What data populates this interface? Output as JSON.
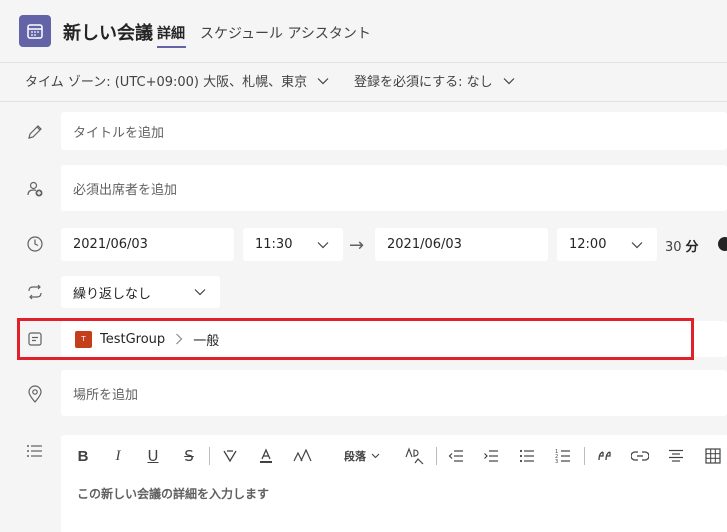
{
  "header": {
    "title": "新しい会議",
    "tabs": [
      {
        "label": "詳細",
        "active": true
      },
      {
        "label": "スケジュール アシスタント",
        "active": false
      }
    ],
    "app_icon": "calendar-icon",
    "accent_color": "#6264a7"
  },
  "options": {
    "timezone": "タイム ゾーン: (UTC+09:00) 大阪、札幌、東京",
    "registration": "登録を必須にする: なし"
  },
  "form": {
    "title_placeholder": "タイトルを追加",
    "attendees_placeholder": "必須出席者を追加",
    "start_date": "2021/06/03",
    "start_time": "11:30",
    "end_date": "2021/06/03",
    "end_time": "12:00",
    "duration_value": "30",
    "duration_unit": "分",
    "repeat": "繰り返しなし",
    "channel": {
      "team_badge": "T",
      "team": "TestGroup",
      "channel": "一般",
      "highlight_color": "#e0202a"
    },
    "location_placeholder": "場所を追加"
  },
  "editor": {
    "paragraph_label": "段落",
    "placeholder": "この新しい会議の詳細を入力します",
    "toolbar_icons": [
      "bold-icon",
      "italic-icon",
      "underline-icon",
      "strikethrough-icon",
      "highlight-icon",
      "font-color-icon",
      "font-size-icon",
      "paragraph-select",
      "clear-format-icon",
      "decrease-indent-icon",
      "increase-indent-icon",
      "bulleted-list-icon",
      "numbered-list-icon",
      "quote-icon",
      "link-icon",
      "align-center-icon",
      "table-icon"
    ]
  }
}
